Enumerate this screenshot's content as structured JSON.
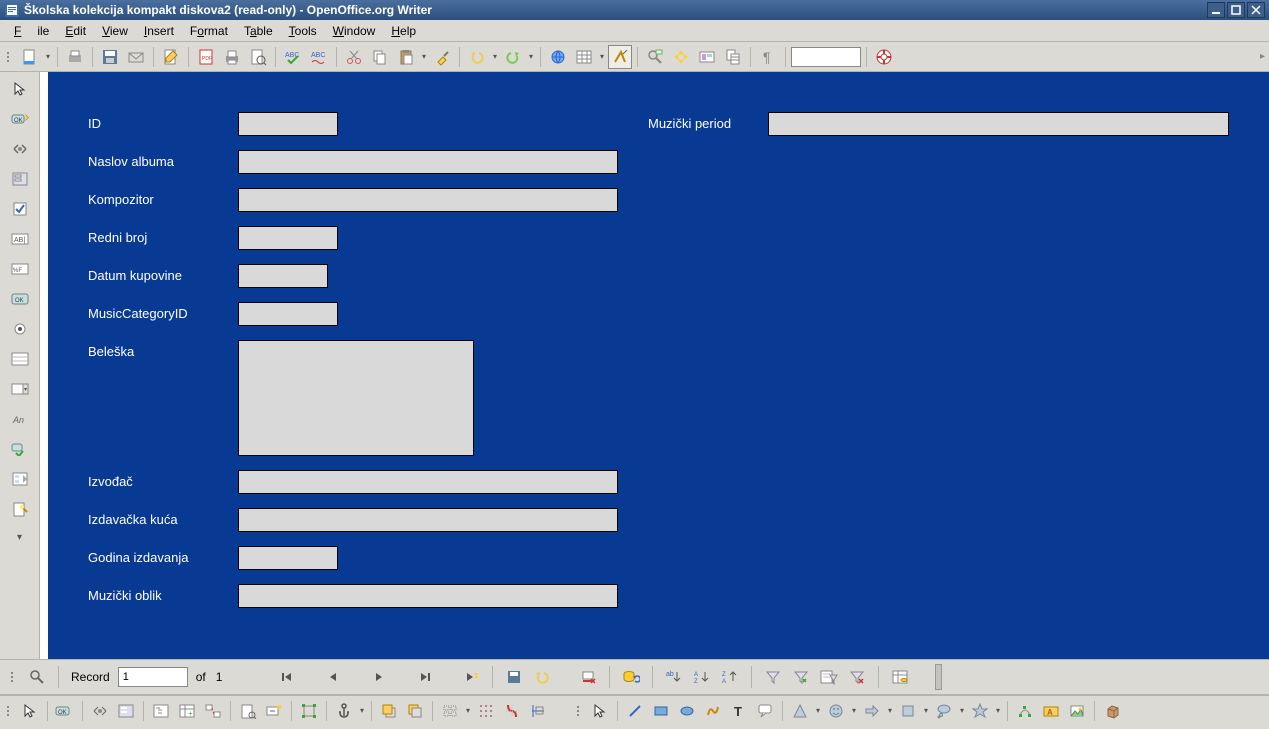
{
  "window": {
    "title": "Školska kolekcija kompakt diskova2 (read-only) - OpenOffice.org Writer"
  },
  "menu": {
    "file": "File",
    "edit": "Edit",
    "view": "View",
    "insert": "Insert",
    "format": "Format",
    "table": "Table",
    "tools": "Tools",
    "window": "Window",
    "help": "Help"
  },
  "form": {
    "id_label": "ID",
    "naslov_label": "Naslov albuma",
    "kompozitor_label": "Kompozitor",
    "redni_label": "Redni broj",
    "datum_label": "Datum kupovine",
    "muscat_label": "MusicCategoryID",
    "beleska_label": "Beleška",
    "izvodjac_label": "Izvođač",
    "izdavacka_label": "Izdavačka kuća",
    "godina_label": "Godina izdavanja",
    "oblik_label": "Muzički oblik",
    "period_label": "Muzički period",
    "id_val": "",
    "naslov_val": "",
    "kompozitor_val": "",
    "redni_val": "",
    "datum_val": "",
    "muscat_val": "",
    "beleska_val": "",
    "izvodjac_val": "",
    "izdavacka_val": "",
    "godina_val": "",
    "oblik_val": "",
    "period_val": ""
  },
  "nav": {
    "record_label": "Record",
    "current": "1",
    "of_label": "of",
    "total": "1"
  }
}
